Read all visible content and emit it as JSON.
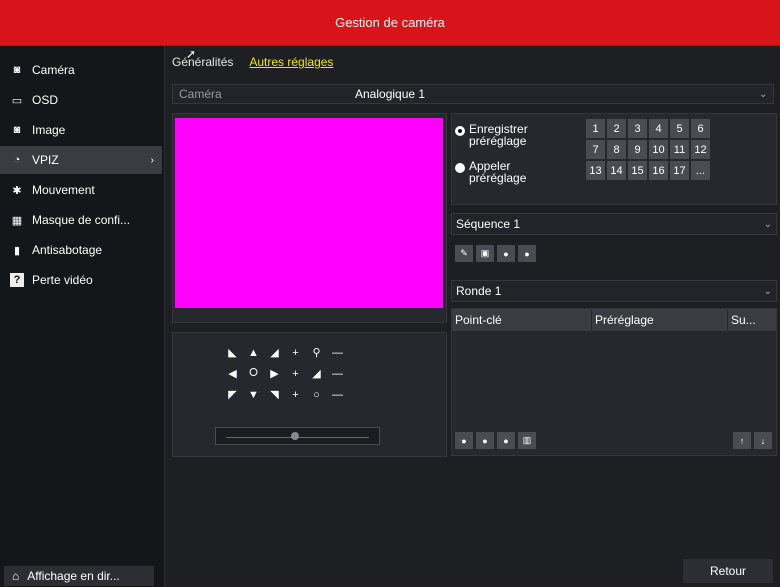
{
  "window": {
    "title": "Gestion de caméra"
  },
  "sidebar": {
    "items": [
      {
        "label": "Caméra",
        "icon": "camera-icon",
        "glyph": "◙"
      },
      {
        "label": "OSD",
        "icon": "monitor-icon",
        "glyph": "▭"
      },
      {
        "label": "Image",
        "icon": "image-icon",
        "glyph": "◙"
      },
      {
        "label": "VPIZ",
        "icon": "ptz-icon",
        "glyph": "◔",
        "active": true
      },
      {
        "label": "Mouvement",
        "icon": "motion-icon",
        "glyph": "✱"
      },
      {
        "label": "Masque de confi...",
        "icon": "privacy-mask-icon",
        "glyph": "▦"
      },
      {
        "label": "Antisabotage",
        "icon": "tamper-icon",
        "glyph": "▮"
      },
      {
        "label": "Perte vidéo",
        "icon": "video-loss-icon",
        "glyph": "?"
      }
    ],
    "home_label": "Affichage en dir..."
  },
  "tabs": [
    {
      "label": "Généralités",
      "active": false
    },
    {
      "label": "Autres réglages",
      "active": true
    }
  ],
  "camera": {
    "label": "Caméra",
    "value": "Analogique 1"
  },
  "preset": {
    "record_label": "Enregistrer préréglage",
    "call_label": "Appeler préréglage",
    "numbers": [
      "1",
      "2",
      "3",
      "4",
      "5",
      "6",
      "7",
      "8",
      "9",
      "10",
      "11",
      "12",
      "13",
      "14",
      "15",
      "16",
      "17",
      "..."
    ]
  },
  "sequence": {
    "value": "Séquence 1"
  },
  "tour": {
    "value": "Ronde 1"
  },
  "table": {
    "columns": [
      "Point-clé",
      "Préréglage",
      "Su..."
    ]
  },
  "buttons": {
    "back": "Retour"
  },
  "colors": {
    "accent": "#d8131a",
    "active_tab": "#f2e600",
    "preview": "#ff00ff"
  }
}
